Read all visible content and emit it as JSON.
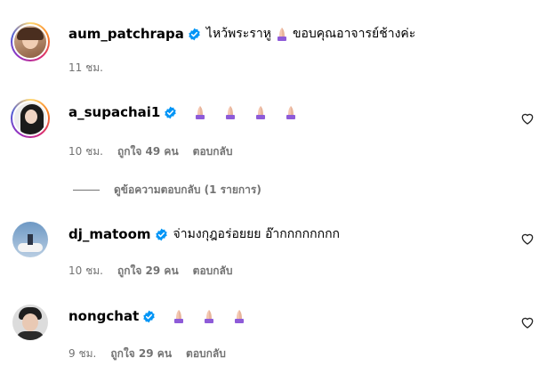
{
  "comments": [
    {
      "username": "aum_patchrapa",
      "text_before": "ไหว้พระราหู",
      "emojis": 1,
      "text_after": "ขอบคุณอาจารย์ช้างค่ะ",
      "time": "11 ชม.",
      "likes": "",
      "reply": "",
      "has_heart": false
    },
    {
      "username": "a_supachai1",
      "text_before": "",
      "emojis": 4,
      "text_after": "",
      "time": "10 ชม.",
      "likes": "ถูกใจ 49 คน",
      "reply": "ตอบกลับ",
      "has_heart": true
    },
    {
      "username": "dj_matoom",
      "text_before": "จ่ามงกุฎอร่อยยย อ๊ากกกกกกกก",
      "emojis": 0,
      "text_after": "",
      "time": "10 ชม.",
      "likes": "ถูกใจ 29 คน",
      "reply": "ตอบกลับ",
      "has_heart": true
    },
    {
      "username": "nongchat",
      "text_before": "",
      "emojis": 3,
      "text_after": "",
      "time": "9 ชม.",
      "likes": "ถูกใจ 29 คน",
      "reply": "ตอบกลับ",
      "has_heart": true
    }
  ],
  "view_replies": "ดูข้อความตอบกลับ (1 รายการ)",
  "colors": {
    "verified": "#0095f6",
    "meta": "#737373",
    "emoji": "#8e5bd8"
  }
}
